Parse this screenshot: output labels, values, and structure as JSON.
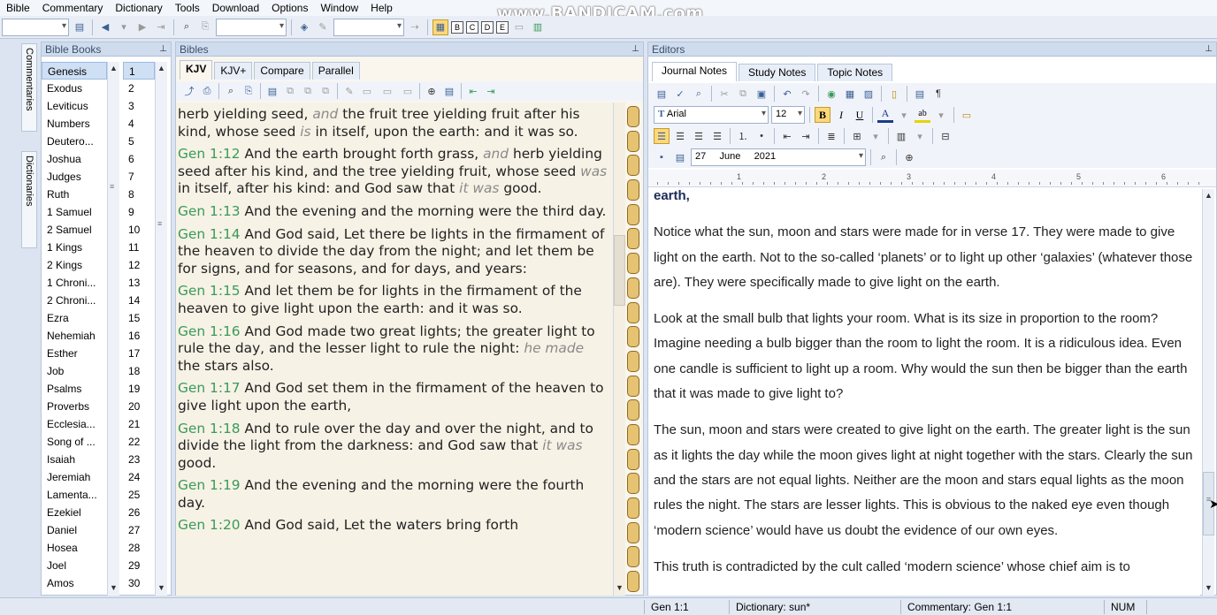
{
  "menu": [
    "Bible",
    "Commentary",
    "Dictionary",
    "Tools",
    "Download",
    "Options",
    "Window",
    "Help"
  ],
  "watermark": "www.BANDICAM.com",
  "side_tabs": {
    "commentaries": "Commentaries",
    "dictionaries": "Dictionaries"
  },
  "books_pane": {
    "title": "Bible Books",
    "books": [
      "Genesis",
      "Exodus",
      "Leviticus",
      "Numbers",
      "Deutero...",
      "Joshua",
      "Judges",
      "Ruth",
      "1 Samuel",
      "2 Samuel",
      "1 Kings",
      "2 Kings",
      "1 Chroni...",
      "2 Chroni...",
      "Ezra",
      "Nehemiah",
      "Esther",
      "Job",
      "Psalms",
      "Proverbs",
      "Ecclesia...",
      "Song of ...",
      "Isaiah",
      "Jeremiah",
      "Lamenta...",
      "Ezekiel",
      "Daniel",
      "Hosea",
      "Joel",
      "Amos"
    ],
    "chapters": [
      "1",
      "2",
      "3",
      "4",
      "5",
      "6",
      "7",
      "8",
      "9",
      "10",
      "11",
      "12",
      "13",
      "14",
      "15",
      "16",
      "17",
      "18",
      "19",
      "20",
      "21",
      "22",
      "23",
      "24",
      "25",
      "26",
      "27",
      "28",
      "29",
      "30"
    ],
    "selected_book": "Genesis",
    "selected_chapter": "1"
  },
  "bibles_pane": {
    "title": "Bibles",
    "tabs": [
      "KJV",
      "KJV+",
      "Compare",
      "Parallel"
    ],
    "active_tab": "KJV",
    "verses": [
      {
        "ref": "",
        "parts": [
          {
            "t": "herb yielding seed, "
          },
          {
            "t": "and",
            "i": true
          },
          {
            "t": " the fruit tree yielding fruit after his kind, whose seed "
          },
          {
            "t": "is",
            "i": true
          },
          {
            "t": " in itself, upon the earth: and it was so."
          }
        ]
      },
      {
        "ref": "Gen 1:12",
        "parts": [
          {
            "t": "  And the earth brought forth grass, "
          },
          {
            "t": "and",
            "i": true
          },
          {
            "t": " herb yielding seed after his kind, and the tree yielding fruit, whose seed "
          },
          {
            "t": "was",
            "i": true
          },
          {
            "t": " in itself, after his kind: and God saw that "
          },
          {
            "t": "it was",
            "i": true
          },
          {
            "t": " good."
          }
        ]
      },
      {
        "ref": "Gen 1:13",
        "parts": [
          {
            "t": "  And the evening and the morning were the third day."
          }
        ]
      },
      {
        "ref": "Gen 1:14",
        "parts": [
          {
            "t": "  And God said, Let there be lights in the firmament of the heaven to divide the day from the night; and let them be for signs, and for seasons, and for days, and years:"
          }
        ]
      },
      {
        "ref": "Gen 1:15",
        "parts": [
          {
            "t": "  And let them be for lights in the firmament of the heaven to give light upon the earth: and it was so."
          }
        ]
      },
      {
        "ref": "Gen 1:16",
        "parts": [
          {
            "t": "  And God made two great lights; the greater light to rule the day, and the lesser light to rule the night: "
          },
          {
            "t": "he made",
            "i": true
          },
          {
            "t": " the stars also."
          }
        ]
      },
      {
        "ref": "Gen 1:17",
        "parts": [
          {
            "t": "  And God set them in the firmament of the heaven to give light upon the earth,"
          }
        ]
      },
      {
        "ref": "Gen 1:18",
        "parts": [
          {
            "t": "  And to rule over the day and over the night, and to divide the light from the darkness: and God saw that "
          },
          {
            "t": "it was",
            "i": true
          },
          {
            "t": " good."
          }
        ]
      },
      {
        "ref": "Gen 1:19",
        "parts": [
          {
            "t": "  And the evening and the morning were the fourth day."
          }
        ]
      },
      {
        "ref": "Gen 1:20",
        "parts": [
          {
            "t": "  And God said, Let the waters bring forth"
          }
        ]
      }
    ]
  },
  "editors_pane": {
    "title": "Editors",
    "tabs": [
      "Journal Notes",
      "Study Notes",
      "Topic Notes"
    ],
    "active_tab": "Journal Notes",
    "font": "Arial",
    "font_size": "12",
    "date": {
      "day": "27",
      "month": "June",
      "year": "2021"
    },
    "ruler": [
      "1",
      "2",
      "3",
      "4",
      "5",
      "6"
    ],
    "paragraphs": [
      "earth,",
      "Notice what the sun, moon and stars were made for in verse 17.  They were made to give light on the earth. Not to the so-called ‘planets’ or to light up other ‘galaxies’ (whatever those are). They were specifically made to give light on the earth.",
      "Look at the small bulb that lights your room. What is its size in proportion to the room? Imagine needing a bulb bigger than the room to light the room. It is a ridiculous idea. Even one candle is sufficient to light up a room. Why would the sun then be bigger than the earth that it was made to give light to?",
      "The sun, moon and stars were created to give light on the earth. The greater light is the sun as it lights the day while the moon gives light at night together with the stars. Clearly the sun and the stars are not equal lights. Neither are the moon and stars equal lights as the moon rules the night. The stars are lesser lights. This is obvious to the naked eye even though ‘modern science’ would have us doubt the evidence of our own eyes.",
      "This truth is contradicted by the cult called ‘modern science’ whose chief aim is to"
    ]
  },
  "status": {
    "verse": "Gen 1:1",
    "dictionary": "Dictionary: sun*",
    "commentary": "Commentary: Gen 1:1",
    "num": "NUM"
  }
}
